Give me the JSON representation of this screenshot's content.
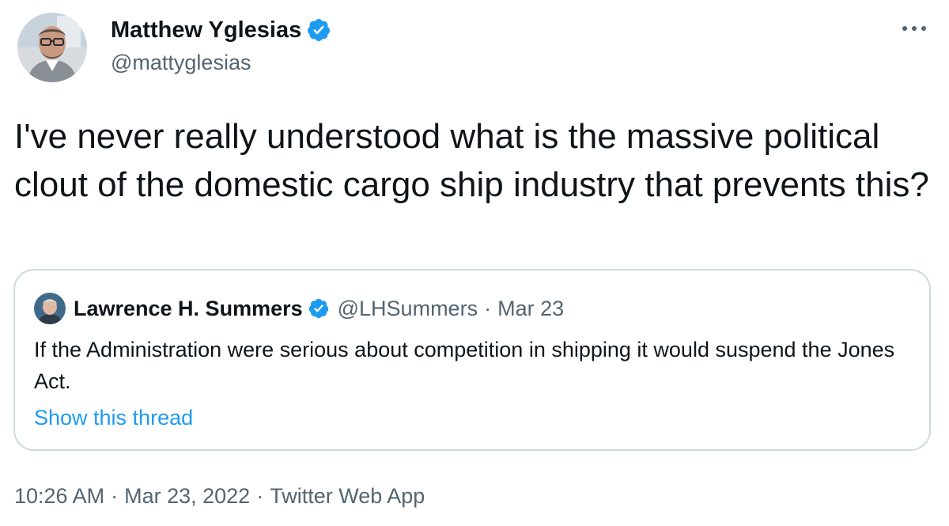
{
  "author": {
    "name": "Matthew Yglesias",
    "handle": "@mattyglesias",
    "verified": true,
    "avatar_icon": "user-avatar-photo"
  },
  "tweet": {
    "text": "I've never really understood what is the massive political clout of the domestic cargo ship industry that prevents this?"
  },
  "more_icon": "more-horizontal-icon",
  "quote": {
    "name": "Lawrence H. Summers",
    "handle": "@LHSummers",
    "separator": "·",
    "date": "Mar 23",
    "verified": true,
    "text": "If the Administration were serious about competition in shipping it would suspend the Jones Act.",
    "link_text": "Show this thread"
  },
  "meta": {
    "time": "10:26 AM",
    "separator": "·",
    "date": "Mar 23, 2022",
    "source": "Twitter Web App"
  },
  "colors": {
    "verified": "#1d9bf0",
    "link": "#1d9bf0",
    "secondary_text": "#536471",
    "border": "#cfd9de"
  }
}
